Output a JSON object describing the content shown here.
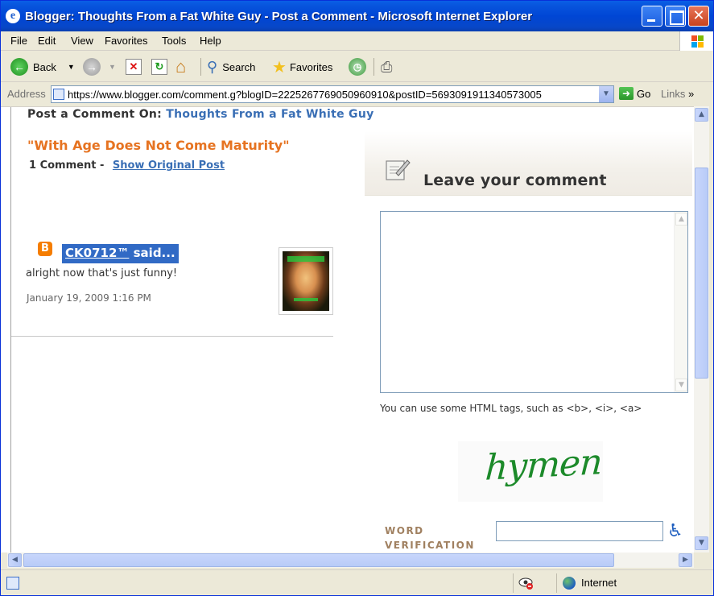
{
  "window": {
    "title": "Blogger: Thoughts From a Fat White Guy - Post a Comment - Microsoft Internet Explorer"
  },
  "menu": [
    "File",
    "Edit",
    "View",
    "Favorites",
    "Tools",
    "Help"
  ],
  "toolbar": {
    "back_label": "Back",
    "search_label": "Search",
    "favorites_label": "Favorites"
  },
  "address": {
    "label": "Address",
    "url": "https://www.blogger.com/comment.g?blogID=2225267769050960910&postID=5693091911340573005",
    "go_label": "Go",
    "links_label": "Links"
  },
  "page": {
    "post_on_label": "Post a Comment On:",
    "blog_name": "Thoughts From a Fat White Guy",
    "post_title": "\"With Age Does Not Come Maturity\"",
    "comment_count": "1 Comment -",
    "show_original": "Show Original Post",
    "comments": [
      {
        "author": "CK0712™",
        "said": "said...",
        "body": "alright now that's just funny!",
        "date": "January 19, 2009 1:16 PM"
      }
    ]
  },
  "form": {
    "heading": "Leave your comment",
    "html_tags_note": "You can use some HTML tags, such as <b>, <i>, <a>",
    "captcha_word": "hymen",
    "word_verification_line1": "WORD",
    "word_verification_line2": "VERIFICATION",
    "word_verification_value": ""
  },
  "status": {
    "zone": "Internet"
  },
  "colors": {
    "title_orange": "#e67321",
    "link_blue": "#3a6fb5",
    "selection_blue": "#316ac5",
    "captcha_green": "#1c8a2a"
  }
}
